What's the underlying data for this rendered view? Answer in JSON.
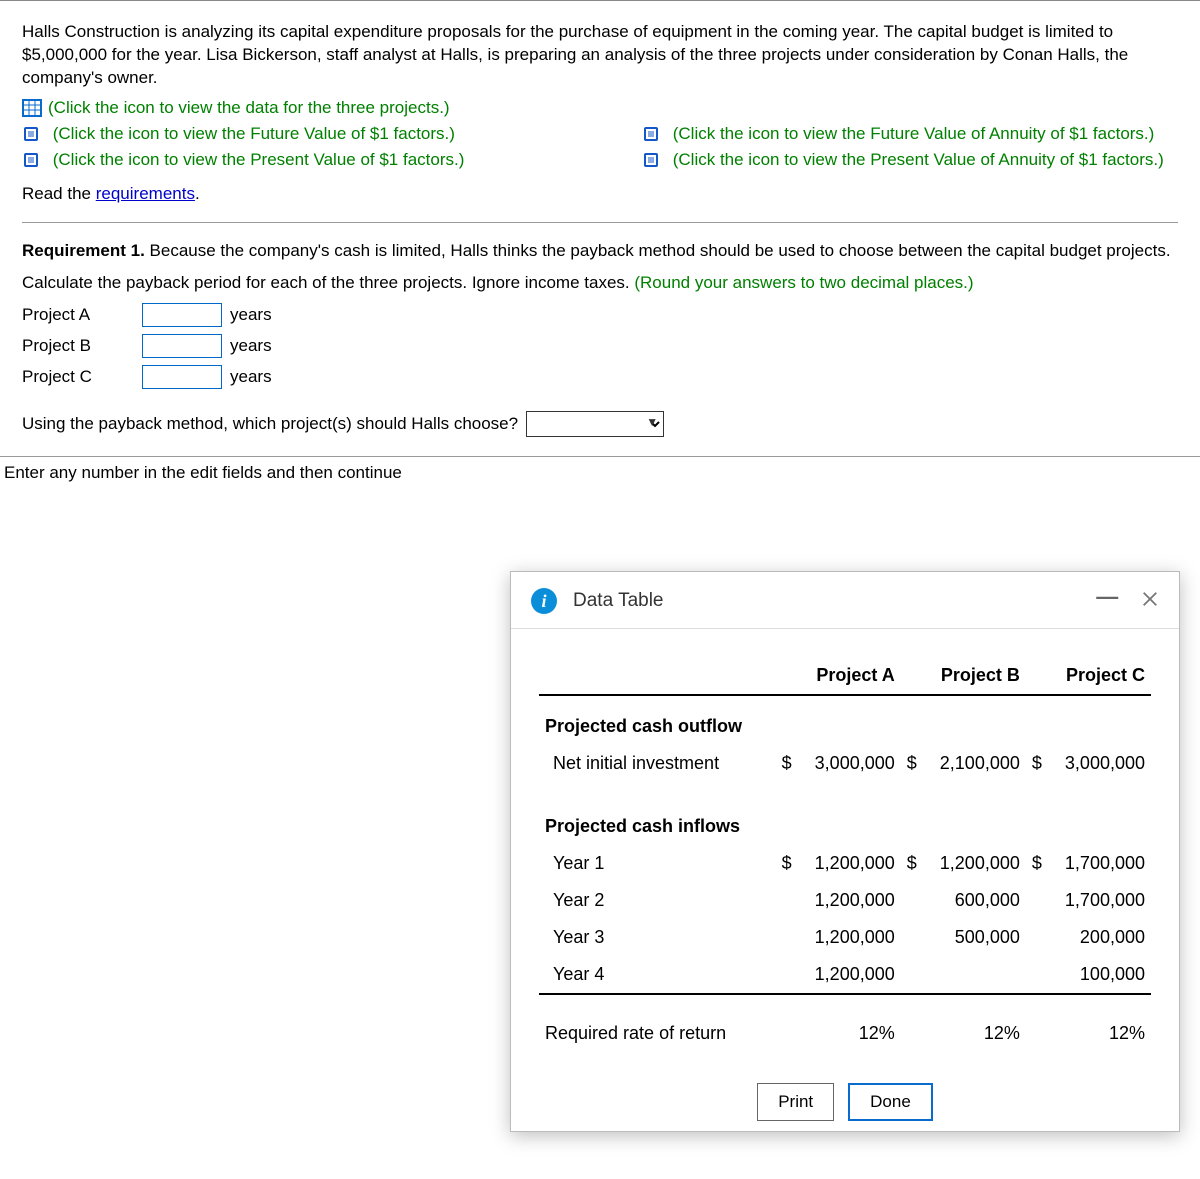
{
  "intro": "Halls Construction is analyzing its capital expenditure proposals for the purchase of equipment in the coming year. The capital budget is limited to $5,000,000 for the year. Lisa Bickerson, staff analyst at Halls, is preparing an analysis of the three projects under consideration by Conan Halls, the company's owner.",
  "links": {
    "data_projects": "(Click the icon to view the data for the three projects.)",
    "fv1": "(Click the icon to view the Future Value of $1 factors.)",
    "fva1": "(Click the icon to view the Future Value of Annuity of $1 factors.)",
    "pv1": "(Click the icon to view the Present Value of $1 factors.)",
    "pva1": "(Click the icon to view the Present Value of Annuity of $1 factors.)"
  },
  "read_req_prefix": "Read the ",
  "read_req_link": "requirements",
  "read_req_suffix": ".",
  "req1_label": "Requirement 1.",
  "req1_text": " Because the company's cash is limited, Halls thinks the payback method should be used to choose between the capital budget projects.",
  "calc_text": "Calculate the payback period for each of the three projects. Ignore income taxes. ",
  "calc_hint": "(Round your answers to two decimal places.)",
  "projects": {
    "a": "Project A",
    "b": "Project B",
    "c": "Project C",
    "unit": "years"
  },
  "choose_q": "Using the payback method, which project(s) should Halls choose?",
  "footer": "Enter any number in the edit fields and then continue",
  "modal": {
    "title": "Data Table",
    "footer_print": "Print",
    "footer_done": "Done",
    "headers": {
      "a": "Project A",
      "b": "Project B",
      "c": "Project C"
    },
    "outflow_head": "Projected cash outflow",
    "outflow_label": "Net initial investment",
    "inflow_head": "Projected cash inflows",
    "rate_label": "Required rate of return",
    "cur": "$",
    "outflow": {
      "a": "3,000,000",
      "b": "2,100,000",
      "c": "3,000,000"
    },
    "y1_label": "Year 1",
    "y2_label": "Year 2",
    "y3_label": "Year 3",
    "y4_label": "Year 4",
    "y1": {
      "a": "1,200,000",
      "b": "1,200,000",
      "c": "1,700,000"
    },
    "y2": {
      "a": "1,200,000",
      "b": "600,000",
      "c": "1,700,000"
    },
    "y3": {
      "a": "1,200,000",
      "b": "500,000",
      "c": "200,000"
    },
    "y4": {
      "a": "1,200,000",
      "b": "",
      "c": "100,000"
    },
    "rate": {
      "a": "12%",
      "b": "12%",
      "c": "12%"
    }
  },
  "chart_data": {
    "type": "table",
    "columns": [
      "Project A",
      "Project B",
      "Project C"
    ],
    "rows": [
      {
        "section": "Projected cash outflow",
        "label": "Net initial investment",
        "values": [
          3000000,
          2100000,
          3000000
        ]
      },
      {
        "section": "Projected cash inflows",
        "label": "Year 1",
        "values": [
          1200000,
          1200000,
          1700000
        ]
      },
      {
        "section": "Projected cash inflows",
        "label": "Year 2",
        "values": [
          1200000,
          600000,
          1700000
        ]
      },
      {
        "section": "Projected cash inflows",
        "label": "Year 3",
        "values": [
          1200000,
          500000,
          200000
        ]
      },
      {
        "section": "Projected cash inflows",
        "label": "Year 4",
        "values": [
          1200000,
          null,
          100000
        ]
      },
      {
        "section": "",
        "label": "Required rate of return",
        "values": [
          0.12,
          0.12,
          0.12
        ]
      }
    ]
  }
}
